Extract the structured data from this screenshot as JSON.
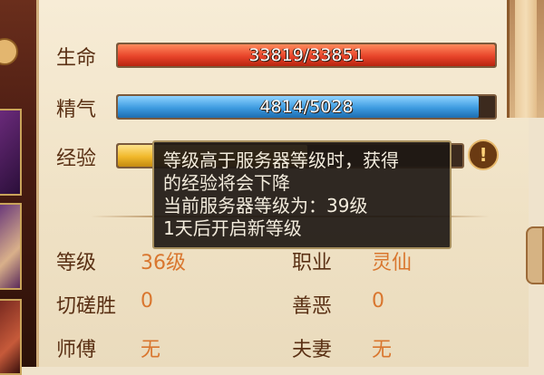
{
  "stats": {
    "hp": {
      "label": "生命",
      "text": "33819/33851",
      "value": 33819,
      "max": 33851
    },
    "spirit": {
      "label": "精气",
      "text": "4814/5028",
      "value": 4814,
      "max": 5028
    },
    "exp": {
      "label": "经验",
      "fraction": 0.55
    }
  },
  "tooltip": {
    "lines": [
      "等级高于服务器等级时，获得",
      "的经验将会下降",
      "当前服务器等级为：39级",
      "1天后开启新等级"
    ]
  },
  "info": {
    "level": {
      "label": "等级",
      "value": "36级"
    },
    "class": {
      "label": "职业",
      "value": "灵仙"
    },
    "duel_wins": {
      "label": "切磋胜",
      "value": "0"
    },
    "karma": {
      "label": "善恶",
      "value": "0"
    },
    "master": {
      "label": "师傅",
      "value": "无"
    },
    "spouse": {
      "label": "夫妻",
      "value": "无"
    }
  },
  "icons": {
    "warning": "exclamation-icon"
  },
  "colors": {
    "hp": "#e8442a",
    "spirit": "#3d9be0",
    "exp": "#f0b82a",
    "value_text": "#d9762e"
  }
}
